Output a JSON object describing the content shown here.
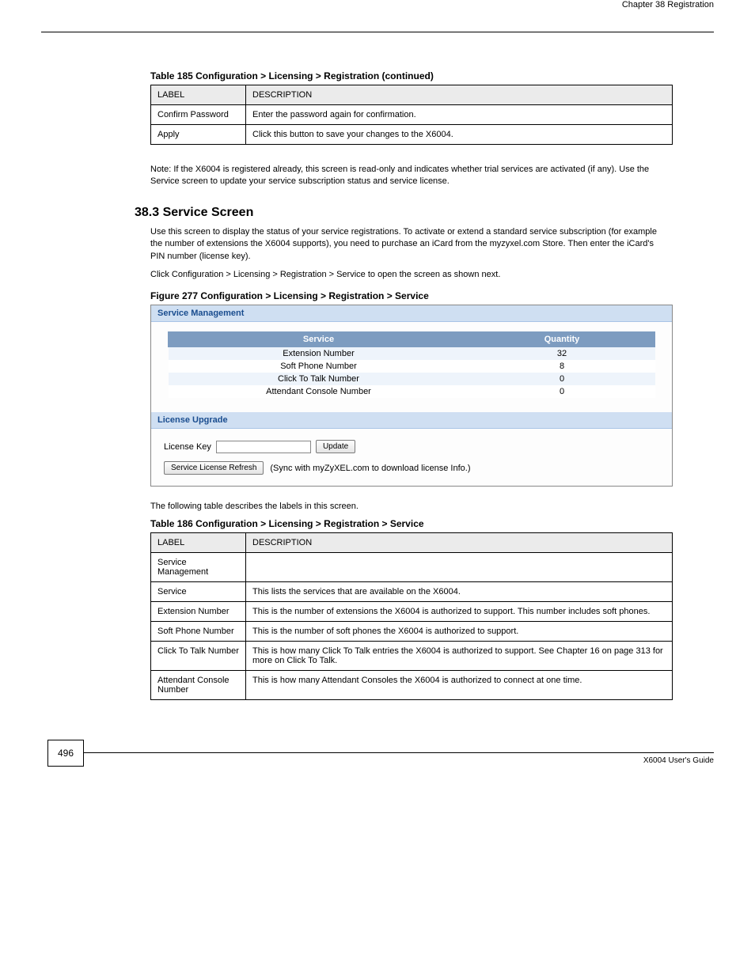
{
  "header": {
    "chapter": "Chapter 38 Registration"
  },
  "table185": {
    "caption": "Table 185   Configuration > Licensing > Registration (continued)",
    "head_label": "LABEL",
    "head_desc": "DESCRIPTION",
    "rows": [
      {
        "label": "Confirm Password",
        "desc": "Enter the password again for confirmation."
      },
      {
        "label": "Apply",
        "desc": "Click this button to save your changes to the X6004."
      }
    ]
  },
  "para": {
    "note": "Note: If the X6004 is registered already, this screen is read-only and indicates whether trial services are activated (if any). Use the Service screen to update your service subscription status and service license."
  },
  "section": {
    "num_title": "38.3  Service Screen",
    "text1": "Use this screen to display the status of your service registrations. To activate or extend a standard service subscription (for example the number of extensions the X6004 supports), you need to purchase an iCard from the myzyxel.com Store. Then enter the iCard's PIN number (license key).",
    "text2": "Click Configuration > Licensing > Registration > Service to open the screen as shown next."
  },
  "figure": {
    "caption": "Figure 277   Configuration > Licensing > Registration > Service"
  },
  "screenshot": {
    "panel1": "Service Management",
    "svc_head_service": "Service",
    "svc_head_qty": "Quantity",
    "svc_rows": [
      {
        "name": "Extension Number",
        "qty": "32"
      },
      {
        "name": "Soft Phone Number",
        "qty": "8"
      },
      {
        "name": "Click To Talk Number",
        "qty": "0"
      },
      {
        "name": "Attendant Console Number",
        "qty": "0"
      }
    ],
    "panel2": "License Upgrade",
    "license_label": "License Key",
    "update_btn": "Update",
    "refresh_btn": "Service License Refresh",
    "refresh_note": "(Sync with myZyXEL.com to download license Info.)"
  },
  "table186": {
    "intro": "The following table describes the labels in this screen.",
    "caption": "Table 186   Configuration > Licensing > Registration > Service",
    "head_label": "LABEL",
    "head_desc": "DESCRIPTION",
    "rows": [
      {
        "label": "Service Management",
        "desc": ""
      },
      {
        "label": "Service",
        "desc": "This lists the services that are available on the X6004."
      },
      {
        "label": "Extension Number",
        "desc": "This is the number of extensions the X6004 is authorized to support. This number includes soft phones."
      },
      {
        "label": "Soft Phone Number",
        "desc": "This is the number of soft phones the X6004 is authorized to support."
      },
      {
        "label": "Click To Talk Number",
        "desc": "This is how many Click To Talk entries the X6004 is authorized to support. See Chapter 16 on page 313 for more on Click To Talk."
      },
      {
        "label": "Attendant Console Number",
        "desc": "This is how many Attendant Consoles the X6004 is authorized to connect at one time."
      }
    ]
  },
  "footer": {
    "page": "496",
    "guide": "X6004 User's Guide"
  }
}
